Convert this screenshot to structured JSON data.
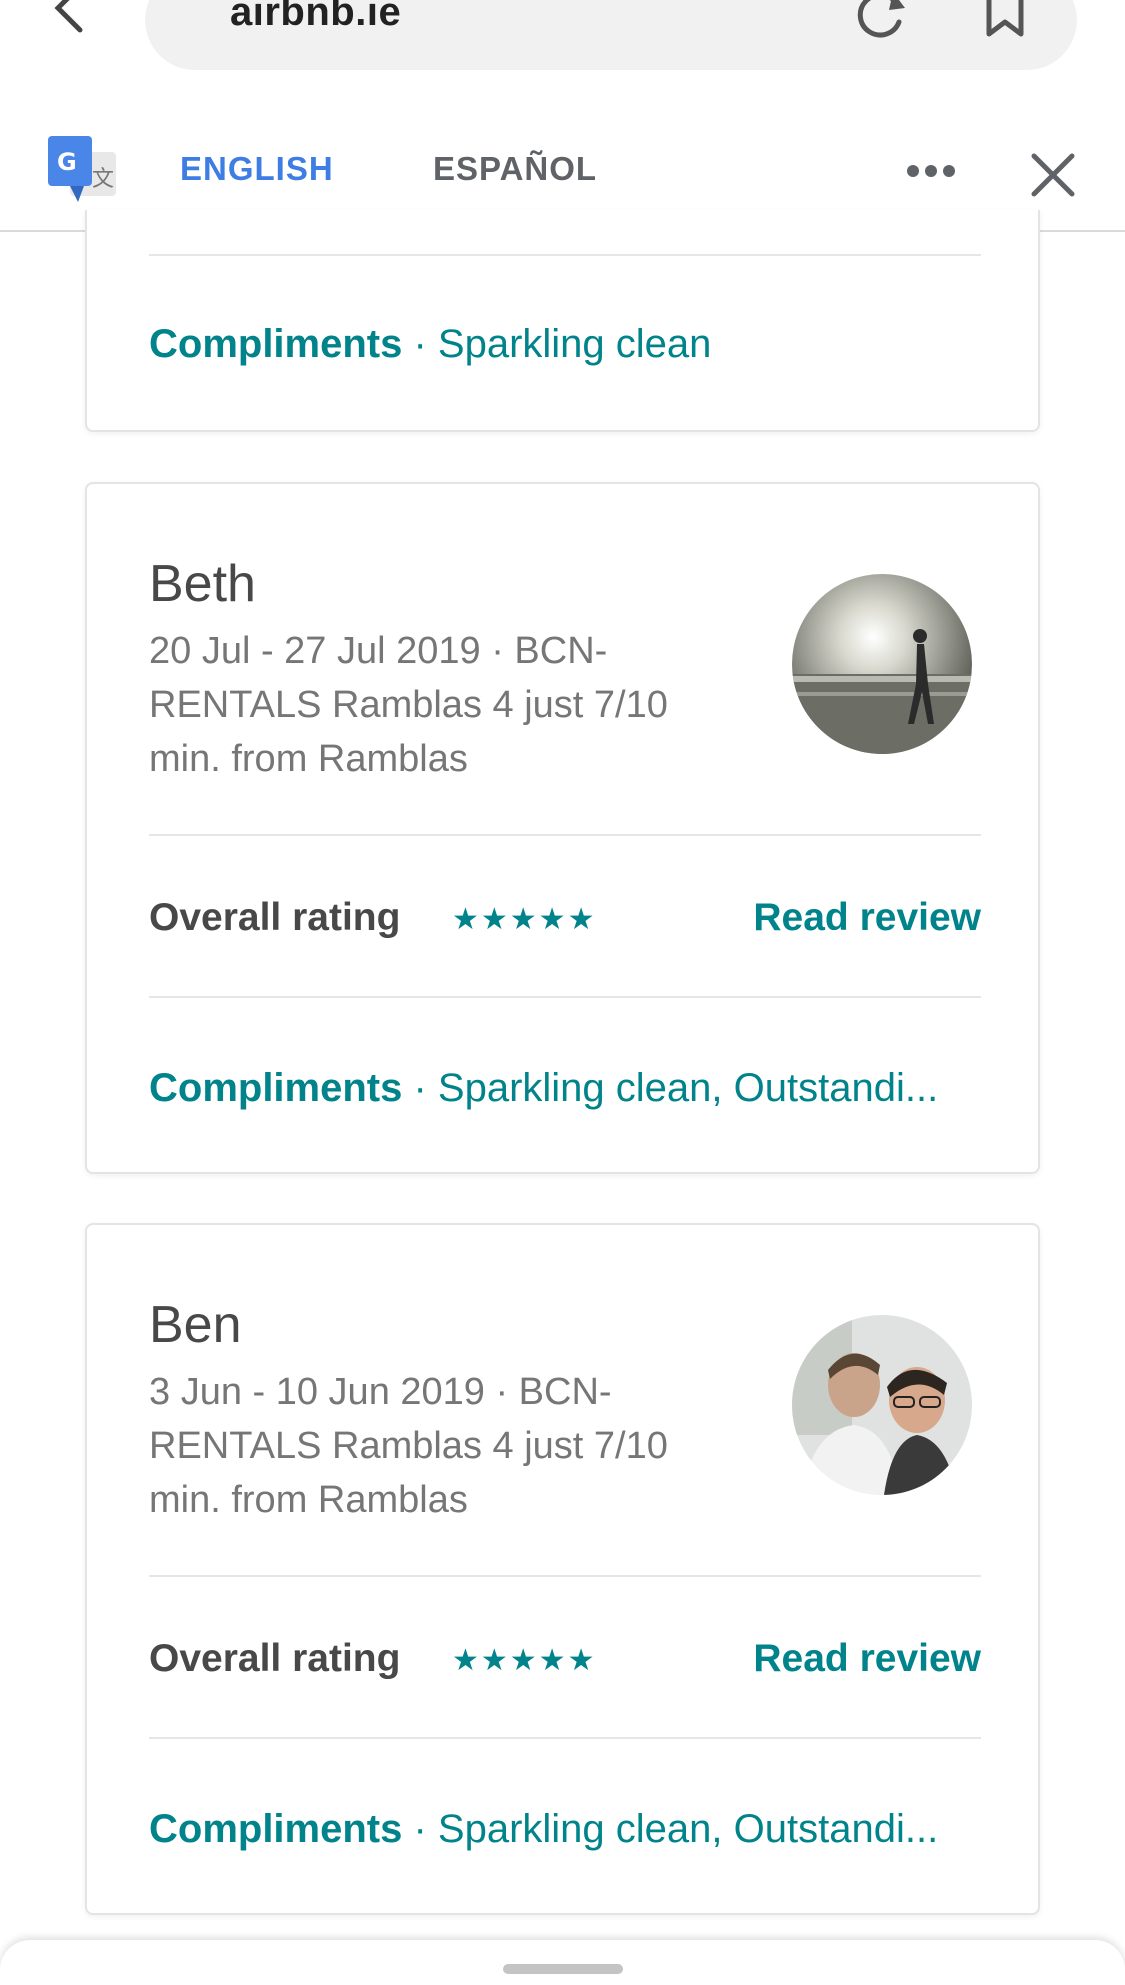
{
  "browser": {
    "url": "airbnb.ie"
  },
  "translate": {
    "tabs": [
      {
        "label": "ENGLISH",
        "active": true
      },
      {
        "label": "ESPAÑOL",
        "active": false
      }
    ],
    "logo_letter": "G"
  },
  "reviews": [
    {
      "compliments_label": "Compliments",
      "compliments_text": "· Sparkling clean"
    },
    {
      "name": "Beth",
      "stay": "20 Jul - 27 Jul 2019 · BCN-RENTALS Ramblas 4 just 7/10 min. from Ramblas",
      "rating_label": "Overall rating",
      "stars": "★★★★★",
      "rating": 5,
      "read_review": "Read review",
      "compliments_label": "Compliments",
      "compliments_text": "· Sparkling clean, Outstandi..."
    },
    {
      "name": "Ben",
      "stay": "3 Jun - 10 Jun 2019 · BCN-RENTALS Ramblas 4 just 7/10 min. from Ramblas",
      "rating_label": "Overall rating",
      "stars": "★★★★★",
      "rating": 5,
      "read_review": "Read review",
      "compliments_label": "Compliments",
      "compliments_text": "· Sparkling clean, Outstandi..."
    }
  ],
  "colors": {
    "accent": "#00838a",
    "translate_blue": "#3d7de4",
    "text": "#484848",
    "muted": "#767676"
  },
  "icons": [
    "back-arrow-icon",
    "reload-icon",
    "bookmark-icon",
    "google-translate-icon",
    "more-horiz-icon",
    "close-icon"
  ]
}
